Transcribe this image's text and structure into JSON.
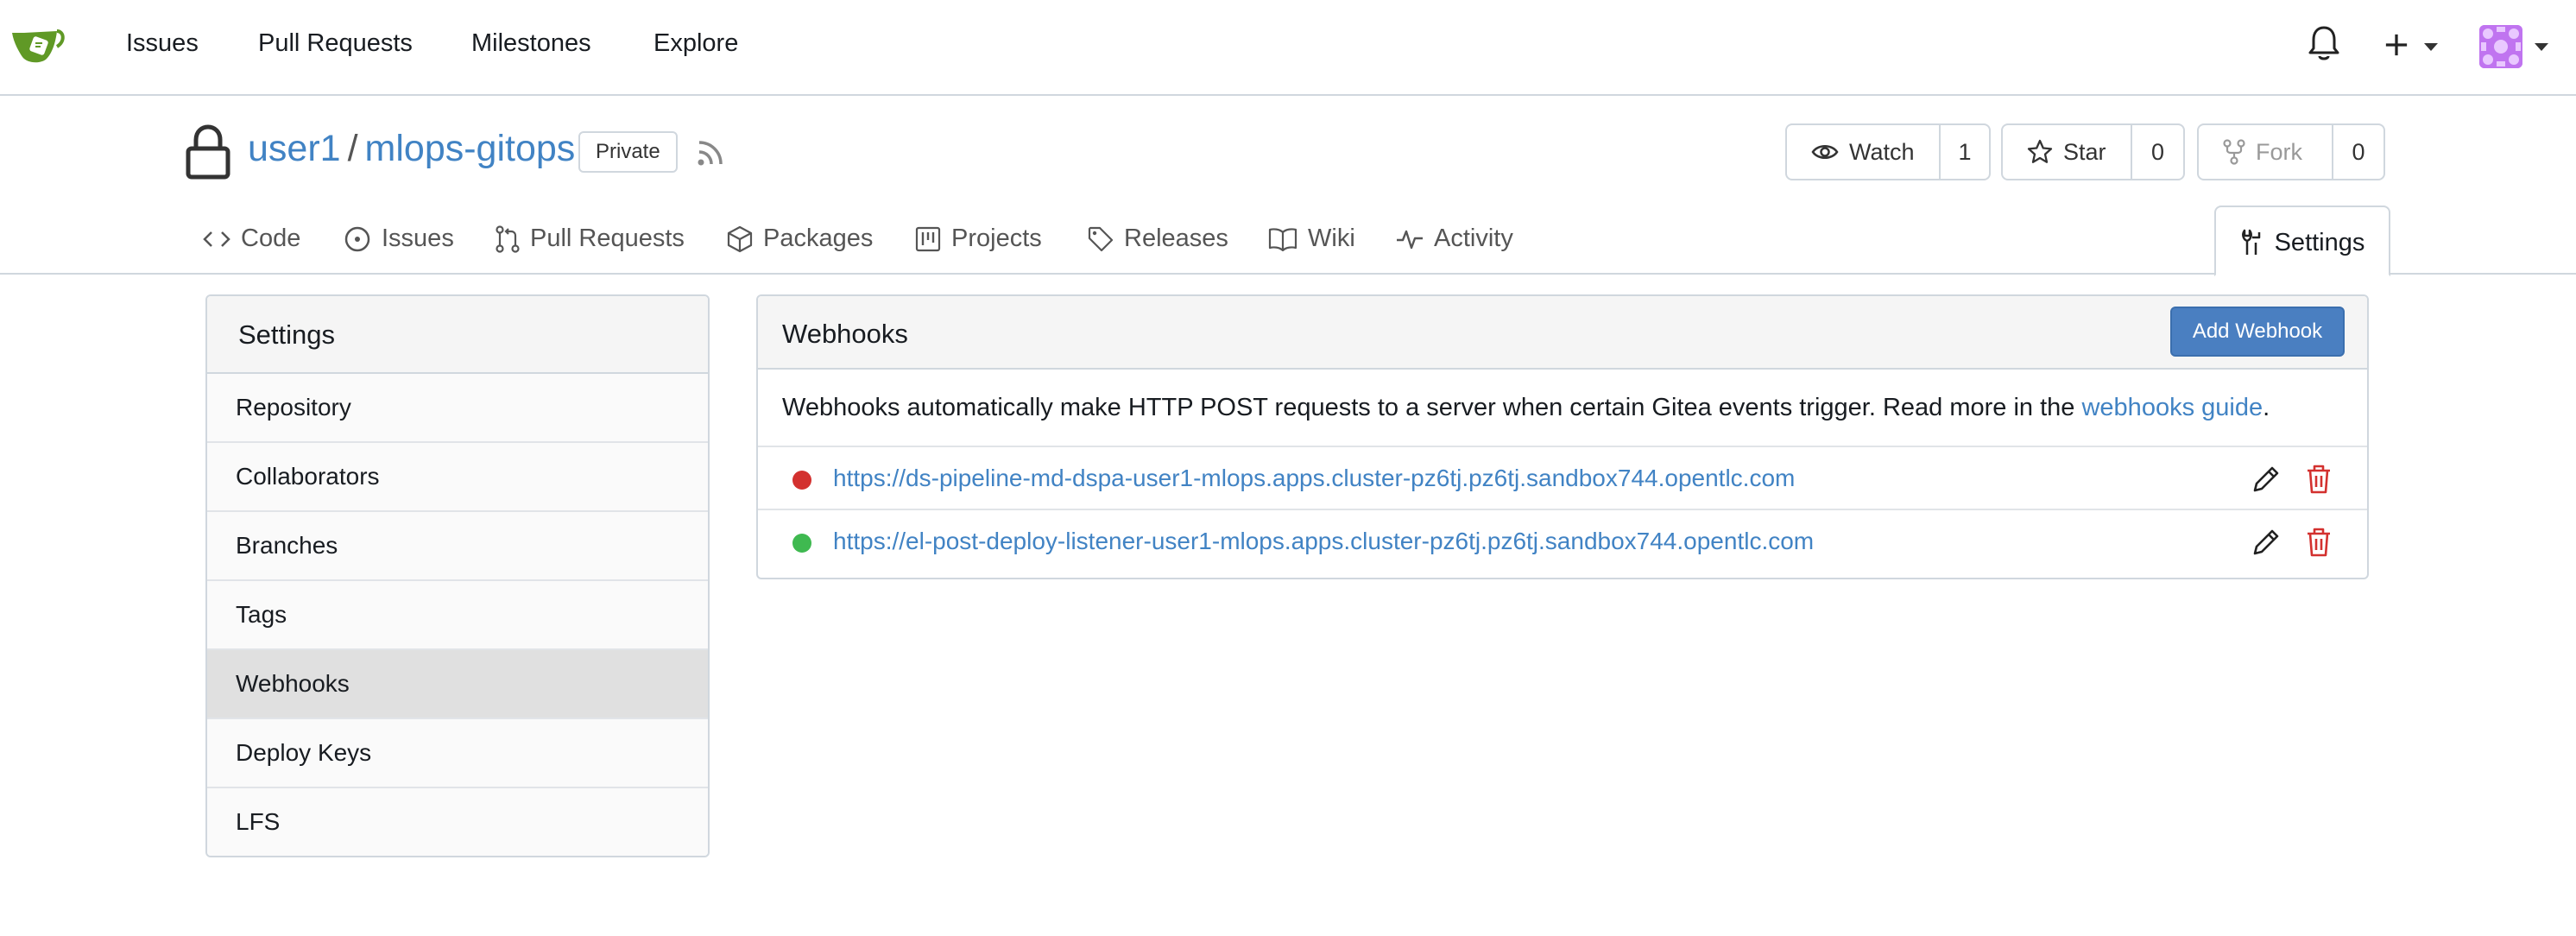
{
  "navbar": {
    "logo_icon": "gitea-logo-icon",
    "links": [
      "Issues",
      "Pull Requests",
      "Milestones",
      "Explore"
    ],
    "notifications_icon": "bell-icon",
    "create_icon": "plus-icon",
    "avatar_color": "#c074f0"
  },
  "repo": {
    "owner": "user1",
    "separator": "/",
    "name": "mlops-gitops",
    "visibility": "Private",
    "watch": {
      "label": "Watch",
      "count": "1"
    },
    "star": {
      "label": "Star",
      "count": "0"
    },
    "fork": {
      "label": "Fork",
      "count": "0"
    }
  },
  "tabs": [
    {
      "label": "Code",
      "icon": "code-icon"
    },
    {
      "label": "Issues",
      "icon": "issue-icon"
    },
    {
      "label": "Pull Requests",
      "icon": "pull-request-icon"
    },
    {
      "label": "Packages",
      "icon": "package-icon"
    },
    {
      "label": "Projects",
      "icon": "project-icon"
    },
    {
      "label": "Releases",
      "icon": "tag-icon"
    },
    {
      "label": "Wiki",
      "icon": "book-icon"
    },
    {
      "label": "Activity",
      "icon": "pulse-icon"
    },
    {
      "label": "Settings",
      "icon": "tools-icon",
      "active": true
    }
  ],
  "sidebar": {
    "title": "Settings",
    "items": [
      "Repository",
      "Collaborators",
      "Branches",
      "Tags",
      "Webhooks",
      "Deploy Keys",
      "LFS"
    ],
    "active": "Webhooks"
  },
  "webhooks": {
    "title": "Webhooks",
    "add_button": "Add Webhook",
    "description_prefix": "Webhooks automatically make HTTP POST requests to a server when certain Gitea events trigger. Read more in the ",
    "guide_link": "webhooks guide",
    "description_suffix": ".",
    "hooks": [
      {
        "url": "https://ds-pipeline-md-dspa-user1-mlops.apps.cluster-pz6tj.pz6tj.sandbox744.opentlc.com",
        "status": "failed",
        "status_color": "#d3312f"
      },
      {
        "url": "https://el-post-deploy-listener-user1-mlops.apps.cluster-pz6tj.pz6tj.sandbox744.opentlc.com",
        "status": "success",
        "status_color": "#3fb950"
      }
    ]
  },
  "colors": {
    "link": "#4183c4",
    "primary_button": "#4a7fc1",
    "delete": "#d3312f"
  }
}
